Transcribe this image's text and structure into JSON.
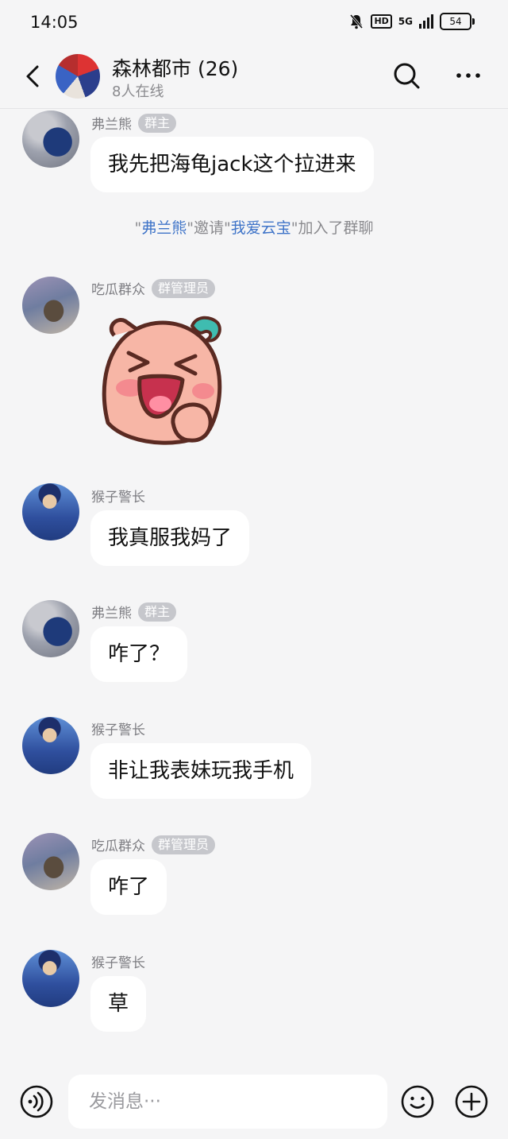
{
  "status_bar": {
    "time": "14:05",
    "hd": "HD",
    "network": "5G",
    "battery": "54"
  },
  "header": {
    "title": "森林都市 (26)",
    "subtitle": "8人在线"
  },
  "messages": [
    {
      "sender": "弗兰熊",
      "role": "群主",
      "text": "我先把海龟jack这个拉进来",
      "avatar": "bear-avatar"
    },
    {
      "system": {
        "q1": "\"",
        "user1": "弗兰熊",
        "q2": "\"邀请\"",
        "user2": "我爱云宝",
        "q3": "\"加入了群聊"
      }
    },
    {
      "sender": "吃瓜群众",
      "role": "群管理员",
      "sticker": "laughing-peach-sticker",
      "avatar": "girl-avatar"
    },
    {
      "sender": "猴子警长",
      "text": "我真服我妈了",
      "avatar": "police-avatar"
    },
    {
      "sender": "弗兰熊",
      "role": "群主",
      "text": "咋了？",
      "avatar": "bear-avatar"
    },
    {
      "sender": "猴子警长",
      "text": "非让我表妹玩我手机",
      "avatar": "police-avatar"
    },
    {
      "sender": "吃瓜群众",
      "role": "群管理员",
      "text": "咋了",
      "avatar": "girl-avatar"
    },
    {
      "sender": "猴子警长",
      "text": "草",
      "avatar": "police-avatar"
    }
  ],
  "input_bar": {
    "placeholder": "发消息···"
  },
  "colors": {
    "background": "#f5f5f6",
    "bubble": "#ffffff",
    "link": "#3f74c8",
    "badge": "#c6c7cc",
    "muted": "#8a8a8e"
  },
  "icons": [
    "back-arrow-icon",
    "search-icon",
    "more-icon",
    "voice-icon",
    "emoji-icon",
    "add-icon",
    "mute-bell-icon"
  ]
}
